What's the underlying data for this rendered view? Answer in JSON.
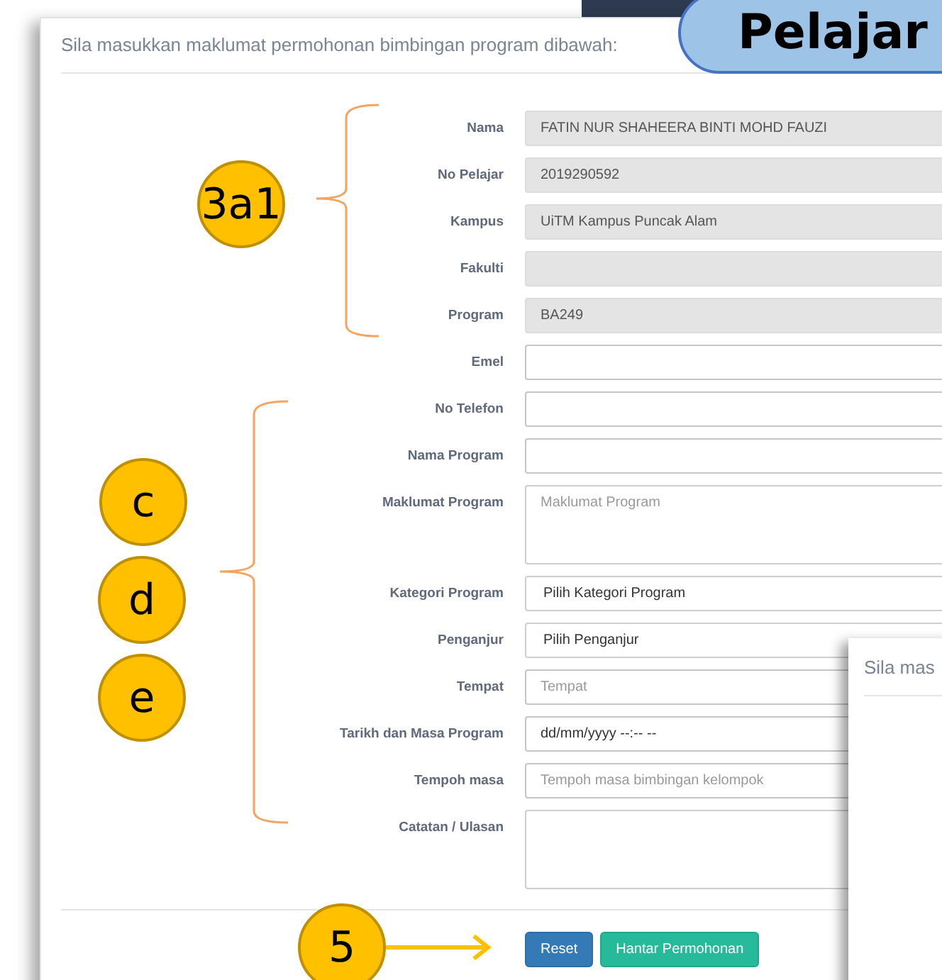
{
  "header": {
    "text": "Sila masukkan maklumat permohonan bimbingan program dibawah:"
  },
  "badge": {
    "text": "Pelajar"
  },
  "fields": [
    {
      "label": "Nama",
      "kind": "input",
      "value": "FATIN NUR SHAHEERA BINTI MOHD FAUZI",
      "disabled": true
    },
    {
      "label": "No Pelajar",
      "kind": "input",
      "value": "2019290592",
      "disabled": true
    },
    {
      "label": "Kampus",
      "kind": "input",
      "value": "UiTM Kampus Puncak Alam",
      "disabled": true
    },
    {
      "label": "Fakulti",
      "kind": "input",
      "disabled": true
    },
    {
      "label": "Program",
      "kind": "input",
      "value": "BA249",
      "disabled": true
    },
    {
      "label": "Emel",
      "kind": "input",
      "disabled": false
    },
    {
      "label": "No Telefon",
      "kind": "input",
      "disabled": false
    },
    {
      "label": "Nama Program",
      "kind": "input",
      "disabled": false
    },
    {
      "label": "Maklumat Program",
      "kind": "textarea",
      "placeholder": "Maklumat Program",
      "disabled": false
    },
    {
      "label": "Kategori Program",
      "kind": "select",
      "value": "Pilih Kategori Program",
      "disabled": false
    },
    {
      "label": "Penganjur",
      "kind": "select",
      "value": "Pilih Penganjur",
      "disabled": false
    },
    {
      "label": "Tempat",
      "kind": "input",
      "placeholder": "Tempat",
      "disabled": false
    },
    {
      "label": "Tarikh dan Masa Program",
      "kind": "input",
      "value": "dd/mm/yyyy --:-- --",
      "disabled": false
    },
    {
      "label": "Tempoh masa",
      "kind": "input",
      "placeholder": "Tempoh masa bimbingan kelompok",
      "disabled": false
    },
    {
      "label": "Catatan / Ulasan",
      "kind": "textarea",
      "disabled": false
    }
  ],
  "buttons": [
    {
      "label": "Reset",
      "kind": "primary"
    },
    {
      "label": "Hantar Permohonan",
      "kind": "success"
    }
  ],
  "annotations": [
    {
      "text": "3a1"
    },
    {
      "text": "c"
    },
    {
      "text": "d"
    },
    {
      "text": "e"
    },
    {
      "text": "5"
    }
  ],
  "overlay_window": {
    "text": "Sila mas"
  }
}
